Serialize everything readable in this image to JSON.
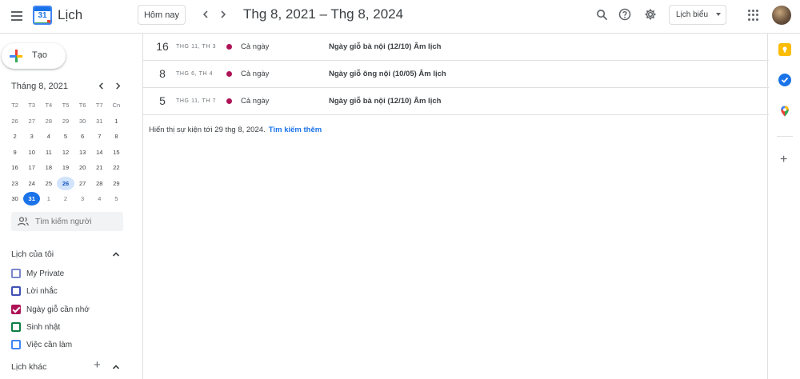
{
  "header": {
    "app_title": "Lịch",
    "logo_number": "31",
    "today_label": "Hôm nay",
    "prev_icon": "chevron-left",
    "next_icon": "chevron-right",
    "range_title": "Thg 8, 2021 – Thg 8, 2024",
    "search_icon": "search",
    "help_icon": "help",
    "settings_icon": "gear",
    "view_label": "Lịch biểu",
    "apps_icon": "apps-grid"
  },
  "sidebar": {
    "create_label": "Tạo",
    "mini_cal": {
      "title": "Tháng 8, 2021",
      "dow": [
        "T2",
        "T3",
        "T4",
        "T5",
        "T6",
        "T7",
        "Cn"
      ],
      "weeks": [
        [
          "26",
          "27",
          "28",
          "29",
          "30",
          "31",
          "1"
        ],
        [
          "2",
          "3",
          "4",
          "5",
          "6",
          "7",
          "8"
        ],
        [
          "9",
          "10",
          "11",
          "12",
          "13",
          "14",
          "15"
        ],
        [
          "16",
          "17",
          "18",
          "19",
          "20",
          "21",
          "22"
        ],
        [
          "23",
          "24",
          "25",
          "26",
          "27",
          "28",
          "29"
        ],
        [
          "30",
          "31",
          "1",
          "2",
          "3",
          "4",
          "5"
        ]
      ]
    },
    "search_people_placeholder": "Tìm kiếm người",
    "my_calendars_title": "Lịch của tôi",
    "my_calendars": [
      {
        "label": "My Private",
        "color": "#7986cb",
        "checked": false
      },
      {
        "label": "Lời nhắc",
        "color": "#3f51b5",
        "checked": false
      },
      {
        "label": "Ngày giỗ cần nhớ",
        "color": "#ad1457",
        "checked": true
      },
      {
        "label": "Sinh nhật",
        "color": "#0b8043",
        "checked": false
      },
      {
        "label": "Việc cần làm",
        "color": "#4285f4",
        "checked": false
      }
    ],
    "other_calendars_title": "Lịch khác"
  },
  "events": [
    {
      "day": "16",
      "dow": "THG 11, TH 3",
      "time": "Cả ngày",
      "title": "Ngày giỗ bà nội (12/10) Âm lịch",
      "color": "#ad1457"
    },
    {
      "day": "8",
      "dow": "THG 6, TH 4",
      "time": "Cả ngày",
      "title": "Ngày giỗ ông nội (10/05) Âm lịch",
      "color": "#ad1457"
    },
    {
      "day": "5",
      "dow": "THG 11, TH 7",
      "time": "Cả ngày",
      "title": "Ngày giỗ bà nội (12/10) Âm lịch",
      "color": "#ad1457"
    }
  ],
  "footer": {
    "note": "Hiển thị sự kiện tới 29 thg 8, 2024.",
    "link": "Tìm kiếm thêm"
  },
  "rail": {
    "icons": [
      "keep-icon",
      "tasks-icon",
      "maps-icon"
    ],
    "colors": [
      "#fbbc04",
      "#1a73e8",
      "#34a853"
    ]
  }
}
